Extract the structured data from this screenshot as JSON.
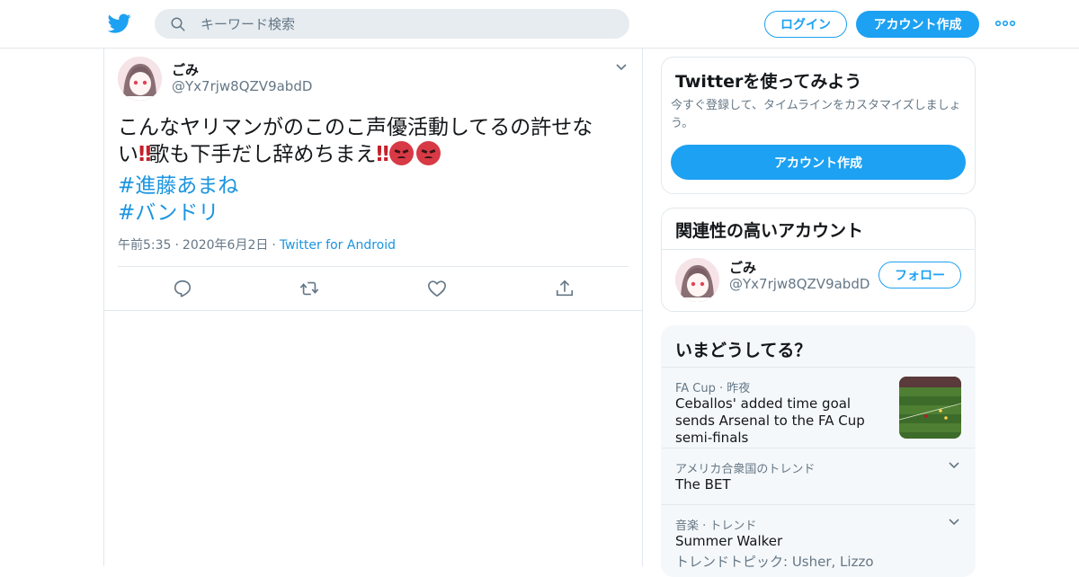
{
  "header": {
    "search_placeholder": "キーワード検索",
    "login_label": "ログイン",
    "signup_label": "アカウント作成"
  },
  "tweet": {
    "user_name": "ごみ",
    "user_handle": "@Yx7rjw8QZV9abdD",
    "text_part1": "こんなヤリマンがのこのこ声優活動してるの許せない",
    "text_part2": "歌も下手だし辞めちまえ",
    "exclamation": "‼",
    "hashtag1": "#進藤あまね",
    "hashtag2": "#バンドリ",
    "time": "午前5:35",
    "date": "2020年6月2日",
    "dot": "·",
    "source": "Twitter for Android"
  },
  "signup_card": {
    "title": "Twitterを使ってみよう",
    "description": "今すぐ登録して、タイムラインをカスタマイズしましょう。",
    "button": "アカウント作成"
  },
  "related_card": {
    "title": "関連性の高いアカウント",
    "user_name": "ごみ",
    "user_handle": "@Yx7rjw8QZV9abdD",
    "follow_label": "フォロー"
  },
  "trends_card": {
    "title": "いまどうしてる？",
    "items": [
      {
        "context": "FA Cup · 昨夜",
        "title": "Ceballos' added time goal sends Arsenal to the FA Cup semi-finals"
      },
      {
        "context": "アメリカ合衆国のトレンド",
        "title": "The BET"
      },
      {
        "context": "音楽 · トレンド",
        "title": "Summer Walker",
        "sub": "トレンドトピック: Usher, Lizzo"
      }
    ]
  },
  "colors": {
    "accent": "#1da1f2",
    "link": "#1b95e0",
    "muted": "#657786",
    "border": "#e1e8ed"
  },
  "icons": [
    "twitter-bird-icon",
    "search-icon",
    "more-dots-icon",
    "chevron-down-icon",
    "reply-icon",
    "retweet-icon",
    "like-icon",
    "share-icon",
    "angry-face-emoji"
  ]
}
